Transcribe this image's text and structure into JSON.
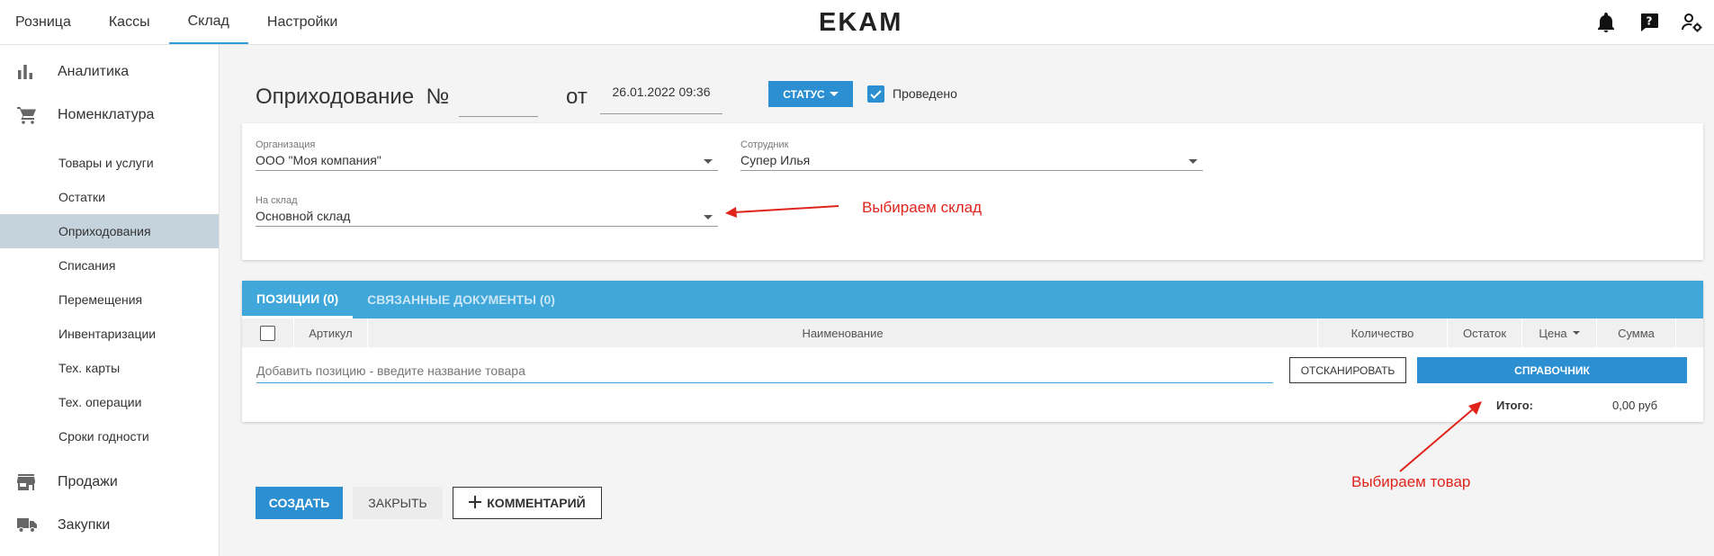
{
  "topnav": {
    "tabs": [
      {
        "label": "Розница"
      },
      {
        "label": "Кассы"
      },
      {
        "label": "Склад"
      },
      {
        "label": "Настройки"
      }
    ],
    "active_tab": "Склад",
    "logo_text": "EKAM"
  },
  "sidebar": {
    "groups": [
      {
        "label": "Аналитика",
        "icon": "bar-chart-icon"
      },
      {
        "label": "Номенклатура",
        "icon": "cart-icon"
      }
    ],
    "nomenclature_items": [
      {
        "label": "Товары и услуги"
      },
      {
        "label": "Остатки"
      },
      {
        "label": "Оприходования"
      },
      {
        "label": "Списания"
      },
      {
        "label": "Перемещения"
      },
      {
        "label": "Инвентаризации"
      },
      {
        "label": "Тех. карты"
      },
      {
        "label": "Тех. операции"
      },
      {
        "label": "Сроки годности"
      }
    ],
    "active_item": "Оприходования",
    "bottom_groups": [
      {
        "label": "Продажи",
        "icon": "store-icon"
      },
      {
        "label": "Закупки",
        "icon": "truck-icon"
      }
    ]
  },
  "document": {
    "title": "Оприходование  №",
    "number_value": "",
    "from_label": "от",
    "date": "26.01.2022 09:36",
    "status_label": "СТАТУС",
    "posted_label": "Проведено",
    "posted_checked": true
  },
  "fields": {
    "organization": {
      "label": "Организация",
      "value": "ООО \"Моя компания\""
    },
    "employee": {
      "label": "Сотрудник",
      "value": "Супер Илья"
    },
    "warehouse": {
      "label": "На склад",
      "value": "Основной склад"
    }
  },
  "annotations": {
    "warehouse": "Выбираем склад",
    "product": "Выбираем товар",
    "color": "#e0241c"
  },
  "positions": {
    "tabs": [
      {
        "label": "ПОЗИЦИИ (0)"
      },
      {
        "label": "СВЯЗАННЫЕ ДОКУМЕНТЫ (0)"
      }
    ],
    "columns": {
      "article": "Артикул",
      "name": "Наименование",
      "quantity": "Количество",
      "stock": "Остаток",
      "price": "Цена",
      "sum": "Сумма"
    },
    "add_placeholder": "Добавить позицию - введите название товара",
    "scan_button": "ОТСКАНИРОВАТЬ",
    "reference_button": "СПРАВОЧНИК",
    "total_label": "Итого:",
    "total_value": "0,00 руб"
  },
  "actions": {
    "create": "СОЗДАТЬ",
    "close": "ЗАКРЫТЬ",
    "comment": "КОММЕНТАРИЙ"
  },
  "colors": {
    "accent": "#2b8fd1",
    "tab_bar": "#3fa7d9",
    "active_sidebar": "#c4d3dc"
  }
}
